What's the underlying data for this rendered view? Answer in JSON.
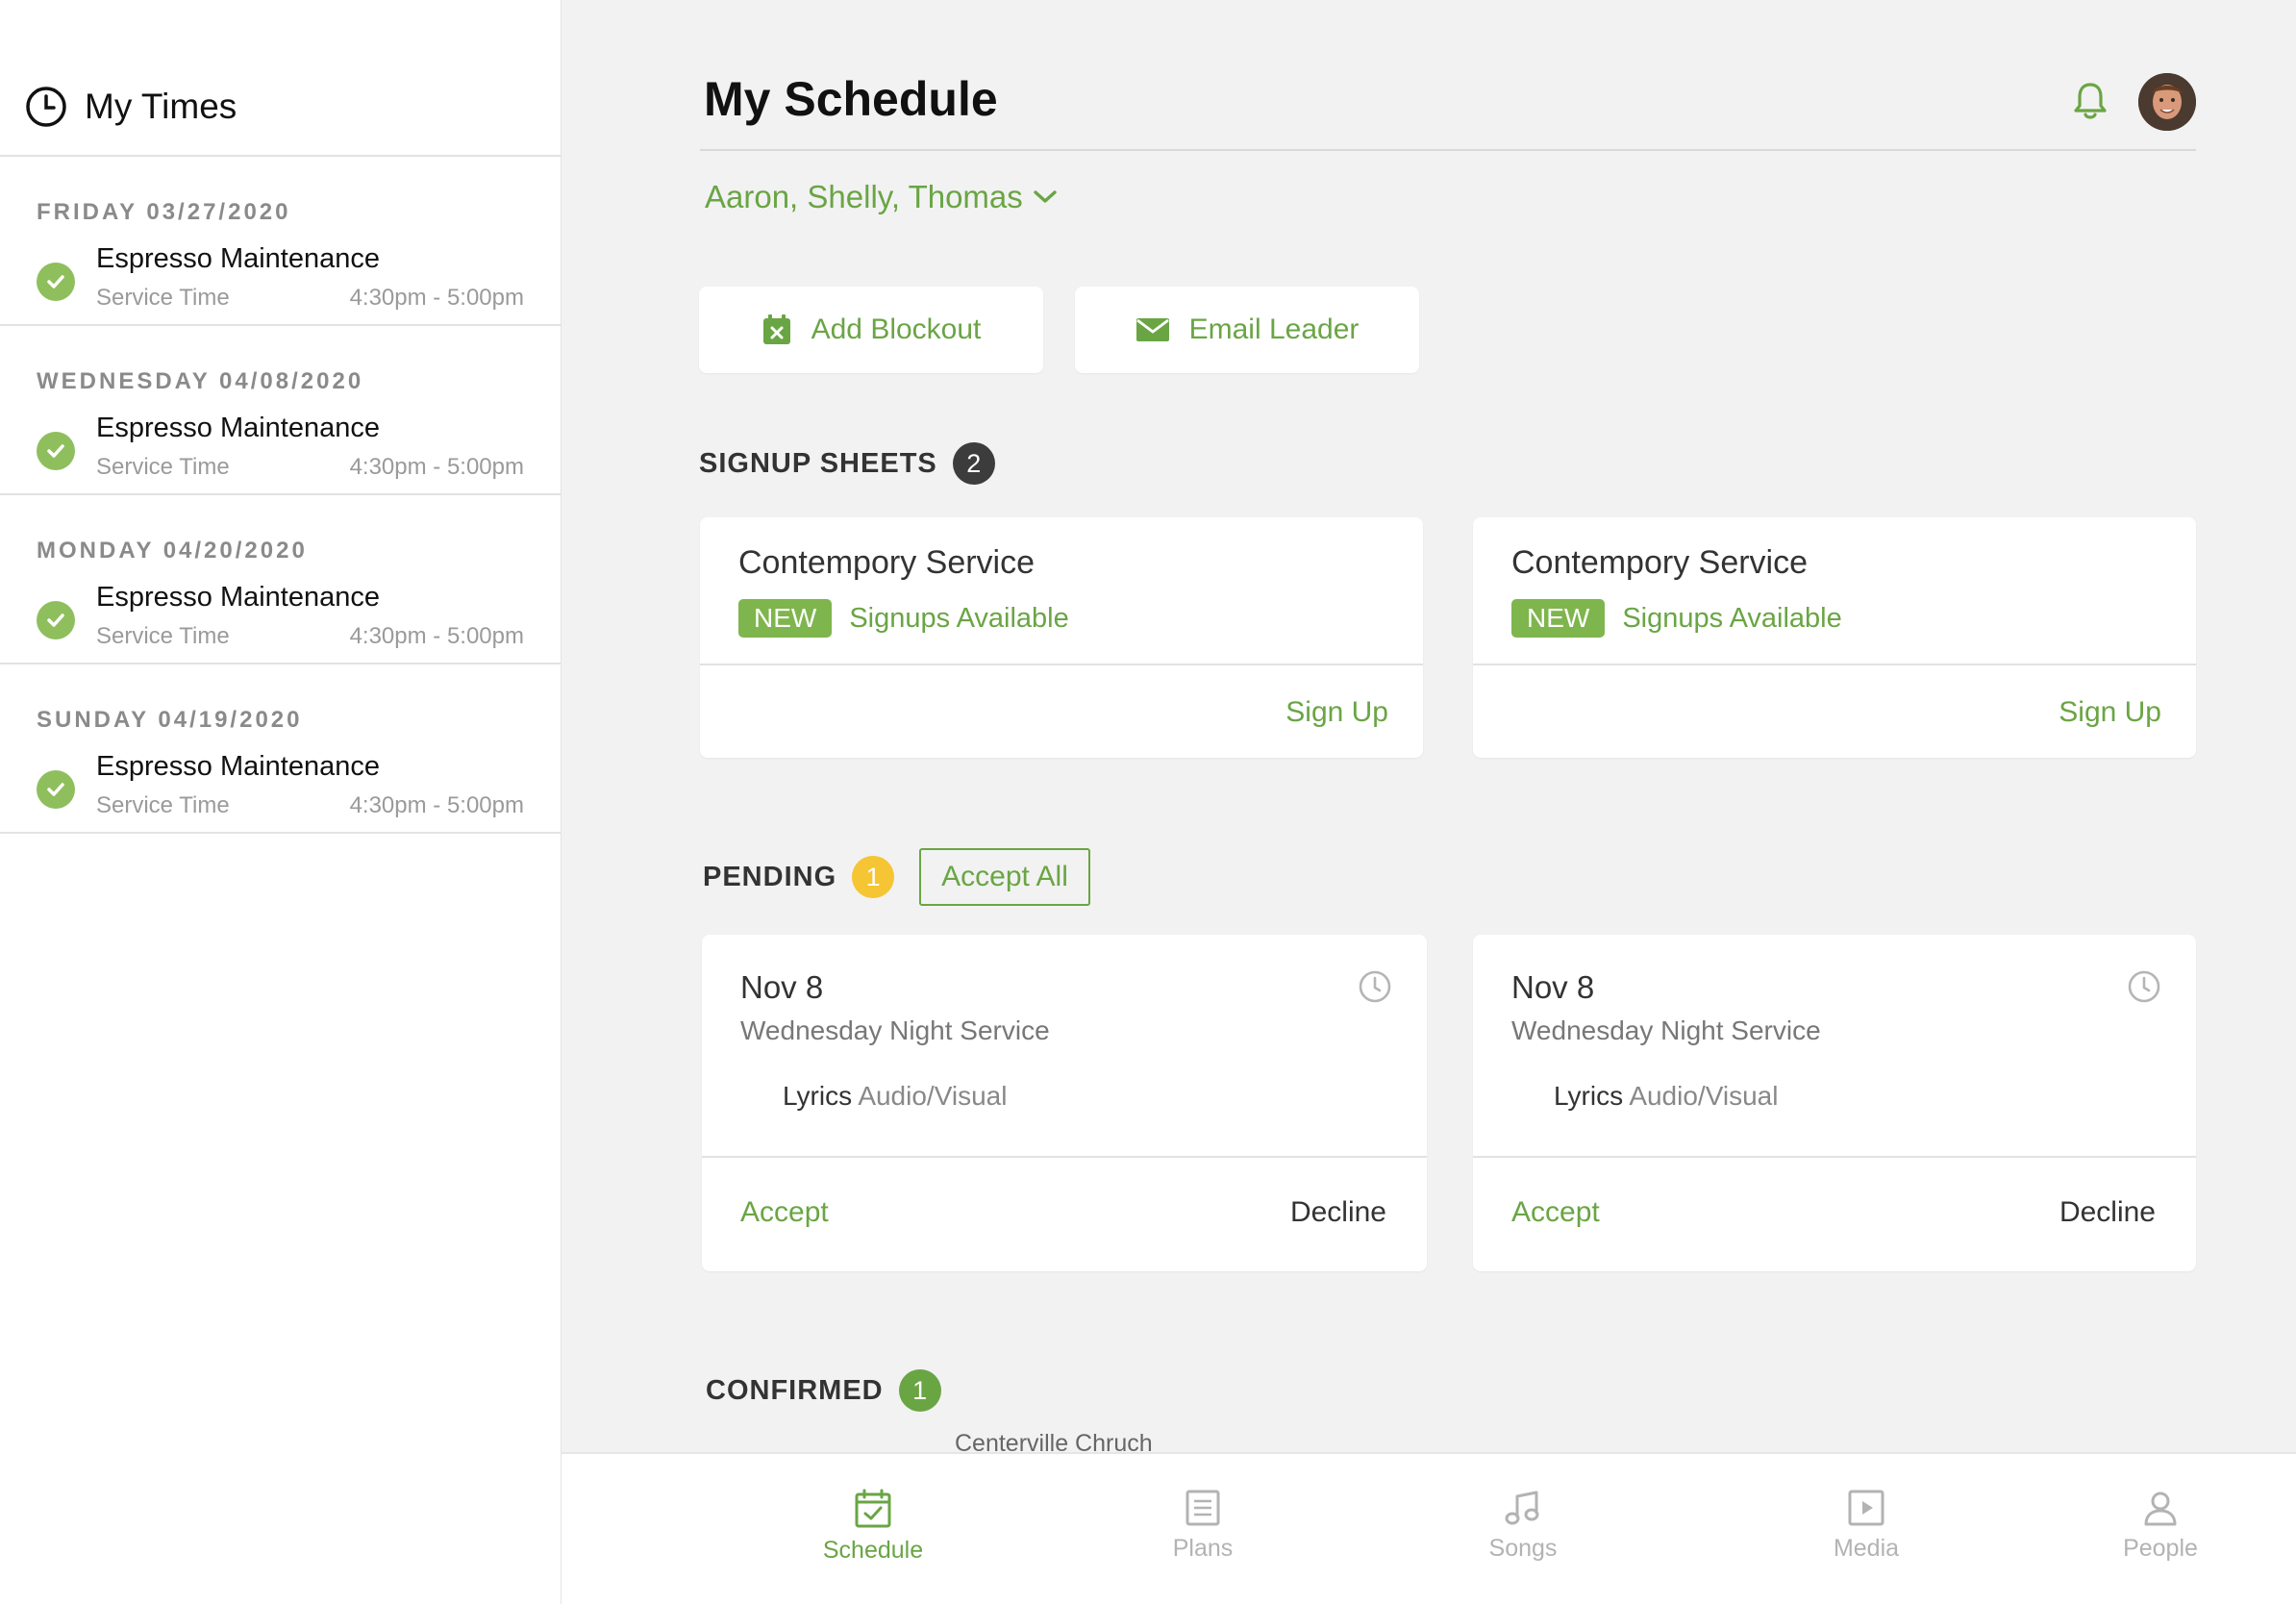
{
  "sidebar": {
    "title": "My Times",
    "entries": [
      {
        "date": "FRIDAY 03/27/2020",
        "name": "Espresso Maintenance",
        "type": "Service Time",
        "time": "4:30pm - 5:00pm"
      },
      {
        "date": "WEDNESDAY 04/08/2020",
        "name": "Espresso Maintenance",
        "type": "Service Time",
        "time": "4:30pm - 5:00pm"
      },
      {
        "date": "MONDAY 04/20/2020",
        "name": "Espresso Maintenance",
        "type": "Service Time",
        "time": "4:30pm - 5:00pm"
      },
      {
        "date": "SUNDAY 04/19/2020",
        "name": "Espresso Maintenance",
        "type": "Service Time",
        "time": "4:30pm - 5:00pm"
      }
    ]
  },
  "header": {
    "title": "My Schedule",
    "team_filter": "Aaron, Shelly, Thomas"
  },
  "actions": {
    "add_blockout": "Add Blockout",
    "email_leader": "Email Leader"
  },
  "signup_sheets": {
    "label": "SIGNUP SHEETS",
    "count": "2",
    "cards": [
      {
        "title": "Contempory Service",
        "badge": "NEW",
        "status": "Signups Available",
        "action": "Sign Up"
      },
      {
        "title": "Contempory Service",
        "badge": "NEW",
        "status": "Signups Available",
        "action": "Sign Up"
      }
    ]
  },
  "pending": {
    "label": "PENDING",
    "count": "1",
    "accept_all": "Accept All",
    "cards": [
      {
        "date": "Nov 8",
        "service": "Wednesday Night Service",
        "role": "Lyrics",
        "team": "Audio/Visual",
        "accept": "Accept",
        "decline": "Decline"
      },
      {
        "date": "Nov 8",
        "service": "Wednesday Night Service",
        "role": "Lyrics",
        "team": "Audio/Visual",
        "accept": "Accept",
        "decline": "Decline"
      }
    ]
  },
  "confirmed": {
    "label": "CONFIRMED",
    "count": "1",
    "first_item_location": "Centerville Chruch"
  },
  "tabbar": {
    "tabs": [
      {
        "label": "Schedule",
        "icon": "calendar-check-icon",
        "active": true
      },
      {
        "label": "Plans",
        "icon": "document-icon",
        "active": false
      },
      {
        "label": "Songs",
        "icon": "music-note-icon",
        "active": false
      },
      {
        "label": "Media",
        "icon": "play-icon",
        "active": false
      },
      {
        "label": "People",
        "icon": "person-icon",
        "active": false
      }
    ]
  },
  "colors": {
    "accent": "#6aa544",
    "check": "#8fbf5d",
    "pending_badge": "#f5c533",
    "signup_badge": "#3c3c3c",
    "confirmed_badge": "#6aa544"
  }
}
